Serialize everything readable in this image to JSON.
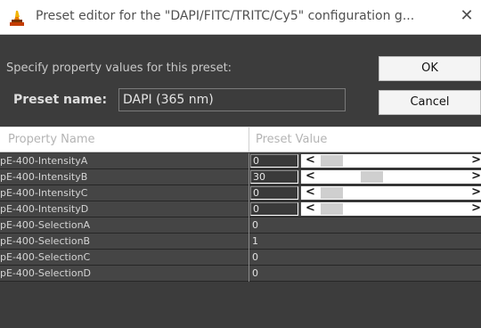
{
  "window": {
    "title": "Preset editor for the \"DAPI/FITC/TRITC/Cy5\" configuration g...",
    "close_glyph": "✕"
  },
  "form": {
    "prompt": "Specify property values for this preset:",
    "preset_name_label": "Preset name:",
    "preset_name_value": "DAPI (365 nm)"
  },
  "buttons": {
    "ok": "OK",
    "cancel": "Cancel"
  },
  "table": {
    "headers": [
      "Property Name",
      "Preset Value"
    ],
    "rows": [
      {
        "name": "pE-400-IntensityA",
        "value": "0",
        "slider": true,
        "level": 0.0
      },
      {
        "name": "pE-400-IntensityB",
        "value": "30",
        "slider": true,
        "level": 0.3
      },
      {
        "name": "pE-400-IntensityC",
        "value": "0",
        "slider": true,
        "level": 0.0
      },
      {
        "name": "pE-400-IntensityD",
        "value": "0",
        "slider": true,
        "level": 0.0
      },
      {
        "name": "pE-400-SelectionA",
        "value": "0",
        "slider": false
      },
      {
        "name": "pE-400-SelectionB",
        "value": "1",
        "slider": false
      },
      {
        "name": "pE-400-SelectionC",
        "value": "0",
        "slider": false
      },
      {
        "name": "pE-400-SelectionD",
        "value": "0",
        "slider": false
      }
    ]
  },
  "icons": {
    "app": "app-icon",
    "close": "close-icon",
    "scroll_left": "chevron-left-icon",
    "scroll_right": "chevron-right-icon"
  },
  "scroll_glyphs": {
    "left": "<",
    "right": ">"
  }
}
